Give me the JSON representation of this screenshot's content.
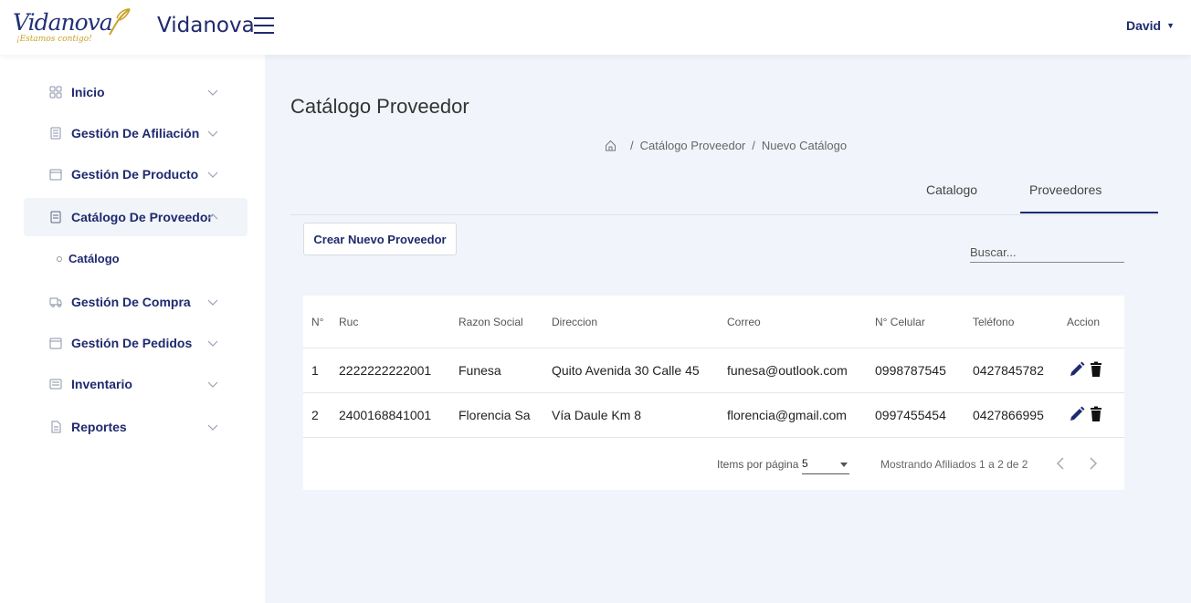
{
  "header": {
    "logo_text": "Vidanova",
    "logo_tagline": "¡Estamos contigo!",
    "brand": "Vidanova",
    "user": "David"
  },
  "sidebar": {
    "items": [
      {
        "label": "Inicio",
        "icon": "grid-icon"
      },
      {
        "label": "Gestión De Afiliación",
        "icon": "list-icon"
      },
      {
        "label": "Gestión De Producto",
        "icon": "box-icon"
      },
      {
        "label": "Catálogo De Proveedor",
        "icon": "document-icon"
      },
      {
        "label": "Gestión De Compra",
        "icon": "truck-icon"
      },
      {
        "label": "Gestión De Pedidos",
        "icon": "box-icon"
      },
      {
        "label": "Inventario",
        "icon": "inventory-icon"
      },
      {
        "label": "Reportes",
        "icon": "report-icon"
      }
    ],
    "sub_item": "Catálogo"
  },
  "main": {
    "title": "Catálogo Proveedor",
    "breadcrumb": [
      "Catálogo Proveedor",
      "Nuevo Catálogo"
    ],
    "tabs": [
      "Catalogo",
      "Proveedores"
    ],
    "create_button": "Crear Nuevo Proveedor",
    "search_placeholder": "Buscar..."
  },
  "table": {
    "headers": [
      "N°",
      "Ruc",
      "Razon Social",
      "Direccion",
      "Correo",
      "N° Celular",
      "Teléfono",
      "Accion"
    ],
    "rows": [
      [
        "1",
        "2222222222001",
        "Funesa",
        "Quito Avenida 30 Calle 45",
        "funesa@outlook.com",
        "0998787545",
        "0427845782"
      ],
      [
        "2",
        "2400168841001",
        "Florencia Sa",
        "Vía Daule Km 8",
        "florencia@gmail.com",
        "0997455454",
        "0427866995"
      ]
    ]
  },
  "pagination": {
    "label": "Items por página",
    "page_size": "5",
    "range": "Mostrando Afiliados 1 a 2 de 2"
  },
  "colors": {
    "primary": "#1f2a6e",
    "gold": "#c9a227",
    "background": "#f1f5fb"
  }
}
